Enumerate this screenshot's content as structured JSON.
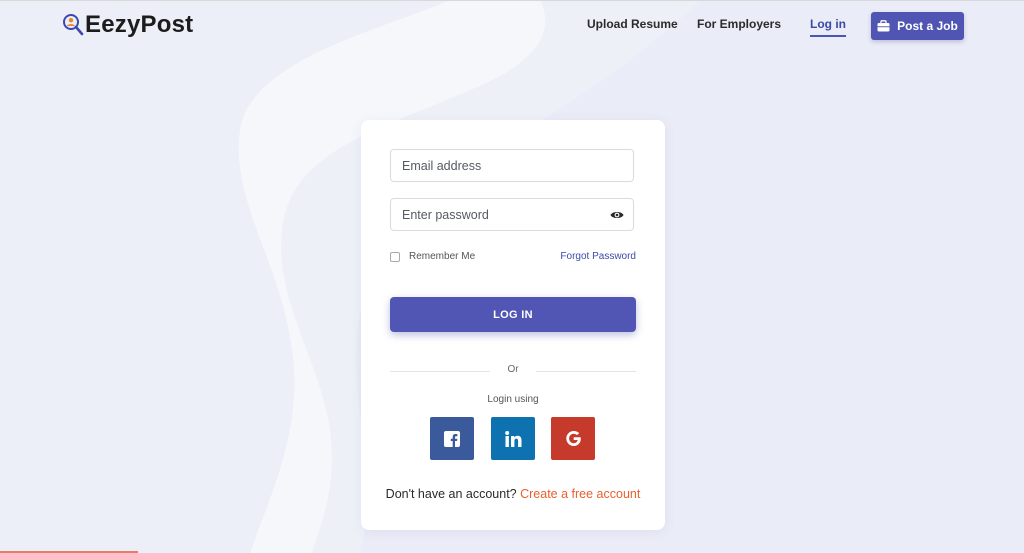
{
  "header": {
    "brand": "EezyPost",
    "nav": {
      "upload_resume": "Upload Resume",
      "for_employers": "For Employers",
      "login": "Log in"
    },
    "post_job_label": "Post a Job"
  },
  "login_form": {
    "email_placeholder": "Email address",
    "password_placeholder": "Enter password",
    "remember_label": "Remember Me",
    "forgot_label": "Forgot Password",
    "submit_label": "LOG IN",
    "or_label": "Or",
    "login_using_label": "Login using",
    "social": [
      "facebook-icon",
      "linkedin-icon",
      "google-icon"
    ],
    "signup_prompt": "Don't have an account?",
    "signup_link": "Create a free account"
  },
  "colors": {
    "accent": "#5156b5",
    "link": "#3b4ba8",
    "signup_link": "#e8602c",
    "facebook": "#3a5a9c",
    "linkedin": "#0e72b0",
    "google": "#c63a2c"
  }
}
